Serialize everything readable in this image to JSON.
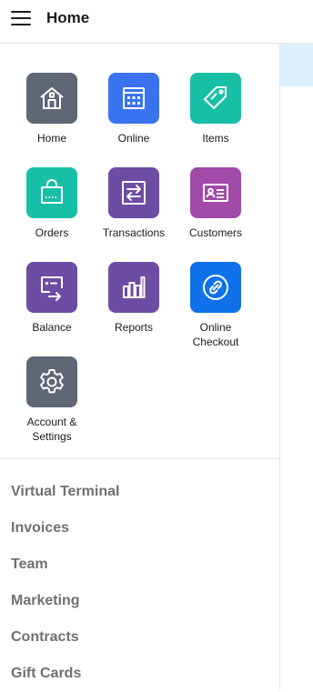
{
  "header": {
    "title": "Home",
    "menu_icon": "hamburger-menu-icon"
  },
  "tiles": [
    {
      "label": "Home",
      "icon": "house-icon",
      "color": "#5f6775"
    },
    {
      "label": "Online",
      "icon": "online-calendar-icon",
      "color": "#3a73f0"
    },
    {
      "label": "Items",
      "icon": "tag-icon",
      "color": "#17bfa6"
    },
    {
      "label": "Orders",
      "icon": "shopping-bag-icon",
      "color": "#17bfa6"
    },
    {
      "label": "Transactions",
      "icon": "transfer-arrows-icon",
      "color": "#6c4da3"
    },
    {
      "label": "Customers",
      "icon": "id-card-icon",
      "color": "#a14aa8"
    },
    {
      "label": "Balance",
      "icon": "balance-transfer-icon",
      "color": "#6c4da3"
    },
    {
      "label": "Reports",
      "icon": "bar-chart-icon",
      "color": "#6c4da3"
    },
    {
      "label": "Online\nCheckout",
      "icon": "link-icon",
      "color": "#0f72ea"
    },
    {
      "label": "Account &\nSettings",
      "icon": "gear-icon",
      "color": "#5f6775"
    }
  ],
  "nav": [
    "Virtual Terminal",
    "Invoices",
    "Team",
    "Marketing",
    "Contracts",
    "Gift Cards"
  ],
  "colors": {
    "accent_pane": "#dcefff",
    "nav_text": "#707070"
  }
}
